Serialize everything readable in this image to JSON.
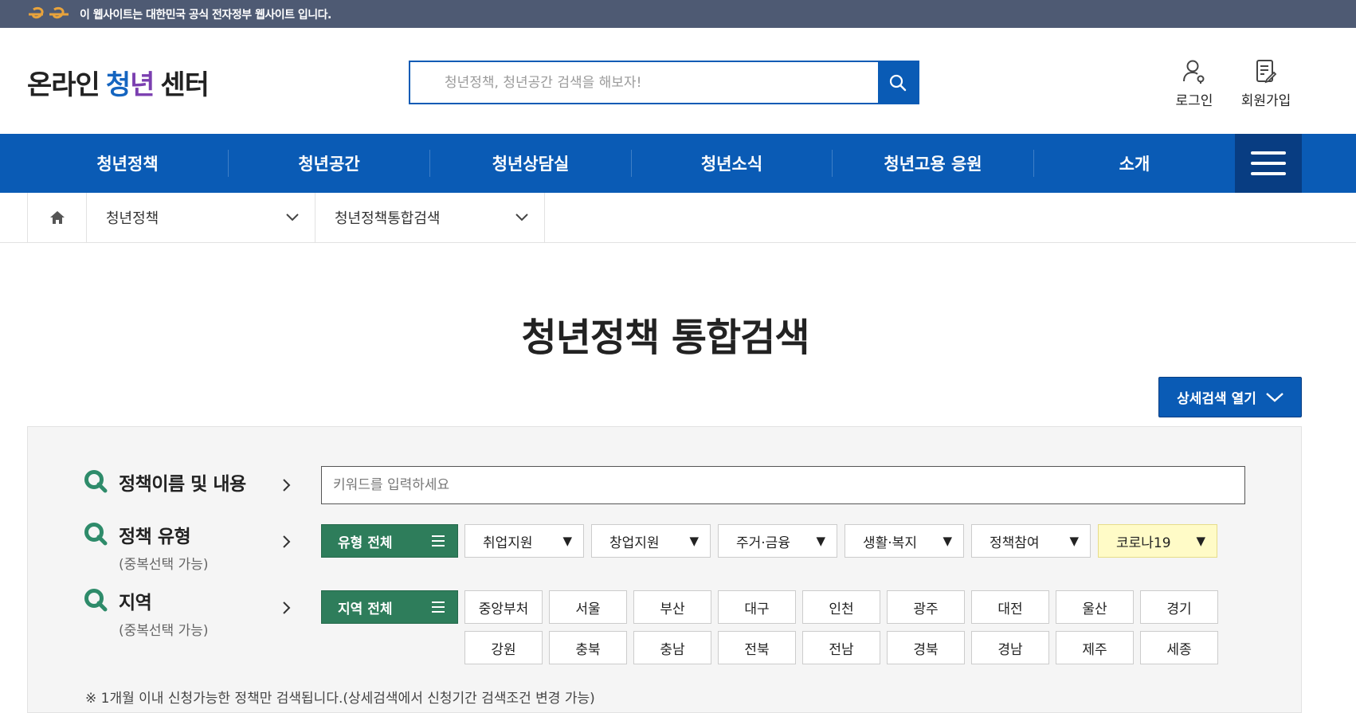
{
  "gov_bar": {
    "text": "이 웹사이트는 대한민국 공식 전자정부 웹사이트 입니다."
  },
  "header": {
    "logo_left": "온라인",
    "logo_mid_1": "청",
    "logo_mid_2": "년",
    "logo_right": "센터",
    "search_placeholder": "청년정책, 청년공간 검색을 해보자!",
    "login_label": "로그인",
    "join_label": "회원가입"
  },
  "gnb": {
    "items": [
      "청년정책",
      "청년공간",
      "청년상담실",
      "청년소식",
      "청년고용 응원",
      "소개"
    ]
  },
  "breadcrumb": {
    "level1": "청년정책",
    "level2": "청년정책통합검색"
  },
  "main": {
    "title": "청년정책 통합검색",
    "detail_button": "상세검색 열기"
  },
  "filters": {
    "keyword": {
      "label": "정책이름 및 내용",
      "placeholder": "키워드를 입력하세요"
    },
    "type": {
      "label": "정책 유형",
      "sub": "(중복선택 가능)",
      "all": "유형 전체",
      "options": [
        "취업지원",
        "창업지원",
        "주거·금융",
        "생활·복지",
        "정책참여",
        "코로나19"
      ]
    },
    "region": {
      "label": "지역",
      "sub": "(중복선택 가능)",
      "all": "지역 전체",
      "row1": [
        "중앙부처",
        "서울",
        "부산",
        "대구",
        "인천",
        "광주",
        "대전",
        "울산",
        "경기"
      ],
      "row2": [
        "강원",
        "충북",
        "충남",
        "전북",
        "전남",
        "경북",
        "경남",
        "제주",
        "세종"
      ]
    },
    "notice": "※ 1개월 이내 신청가능한 정책만 검색됩니다.(상세검색에서 신청기간 검색조건 변경 가능)"
  },
  "colors": {
    "primary": "#0a5bb5",
    "green": "#2e7d5b",
    "highlight": "#fffbc7",
    "gov_bar": "#4e5a73"
  }
}
